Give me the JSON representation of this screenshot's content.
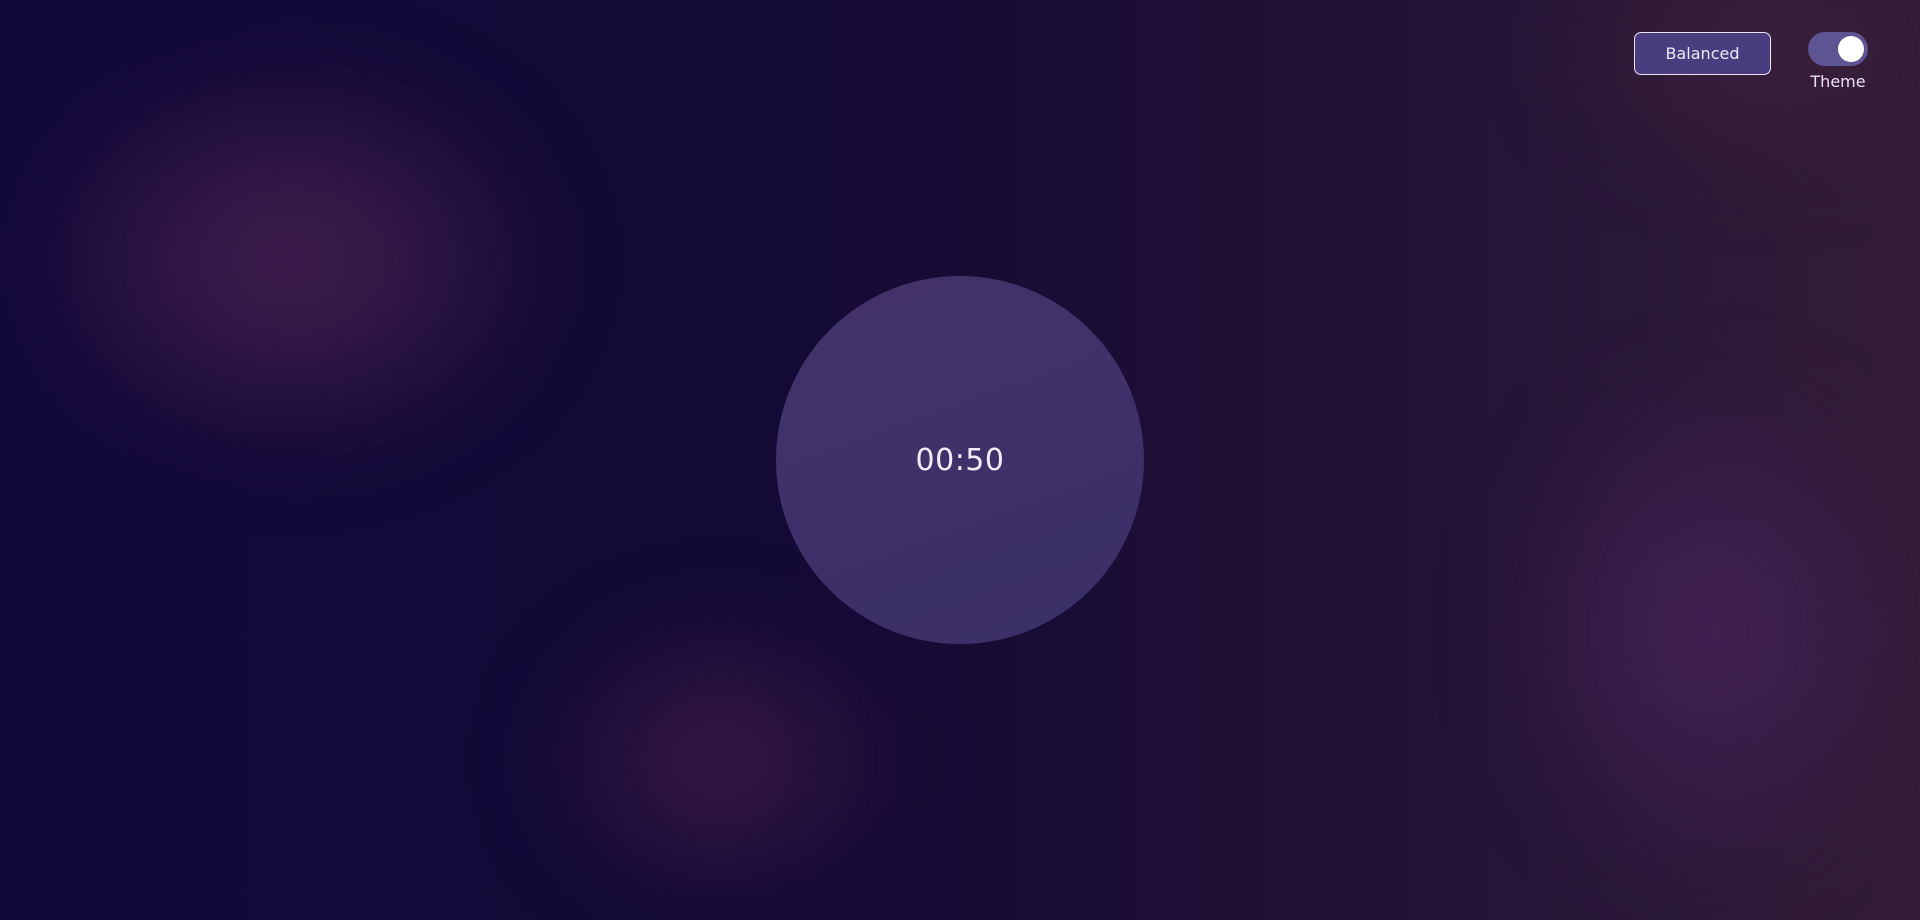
{
  "header": {
    "mode_button_label": "Balanced",
    "theme_toggle": {
      "label": "Theme",
      "state": "on"
    }
  },
  "timer": {
    "display": "00:50"
  },
  "colors": {
    "background_left": "#12093a",
    "background_right": "#331d38",
    "timer_circle": "#3e3169",
    "mode_button_fill": "#4a3d7f",
    "toggle_track": "#5d5494",
    "text": "#f1ecfa"
  }
}
